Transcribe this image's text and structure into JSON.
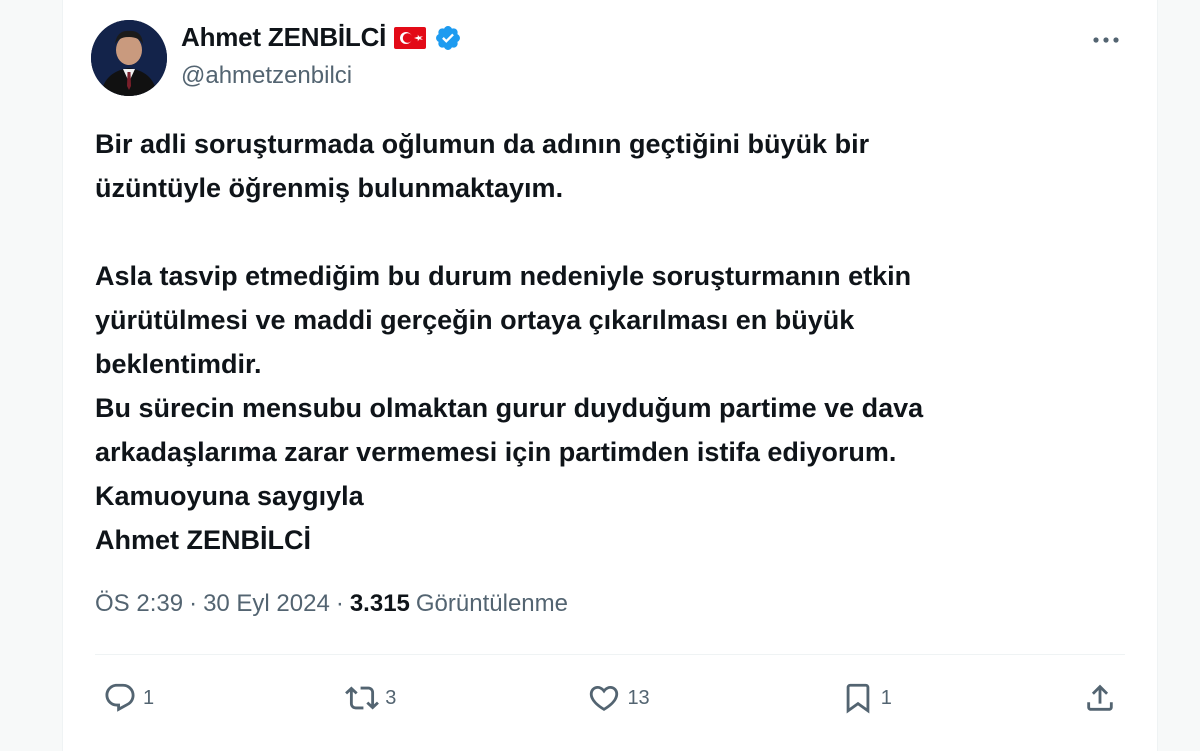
{
  "tweet": {
    "author": {
      "display_name": "Ahmet ZENBİLCİ",
      "handle": "@ahmetzenbilci",
      "verified": true,
      "flag": "turkey-flag-icon",
      "verified_icon": "verified-badge-icon"
    },
    "text": "Bir adli soruşturmada oğlumun da adının geçtiğini büyük bir\nüzüntüyle öğrenmiş bulunmaktayım.\n\nAsla tasvip etmediğim bu durum nedeniyle soruşturmanın etkin\nyürütülmesi ve maddi gerçeğin ortaya çıkarılması en büyük\nbeklentimdir.\nBu sürecin mensubu olmaktan gurur duyduğum partime ve dava\narkadaşlarıma zarar vermemesi için partimden istifa ediyorum.\nKamuoyuna saygıyla\nAhmet ZENBİLCİ",
    "time": "ÖS 2:39",
    "date": "30 Eyl 2024",
    "separator": "·",
    "views_count": "3.315",
    "views_label": "Görüntülenme",
    "actions": {
      "reply": {
        "icon": "reply-icon",
        "count": "1"
      },
      "retweet": {
        "icon": "retweet-icon",
        "count": "3"
      },
      "like": {
        "icon": "heart-icon",
        "count": "13"
      },
      "bookmark": {
        "icon": "bookmark-icon",
        "count": "1"
      },
      "share": {
        "icon": "share-icon"
      }
    }
  },
  "colors": {
    "text_primary": "#0f1419",
    "text_secondary": "#536471",
    "verified_blue": "#1d9bf0",
    "flag_red": "#e30a17"
  }
}
